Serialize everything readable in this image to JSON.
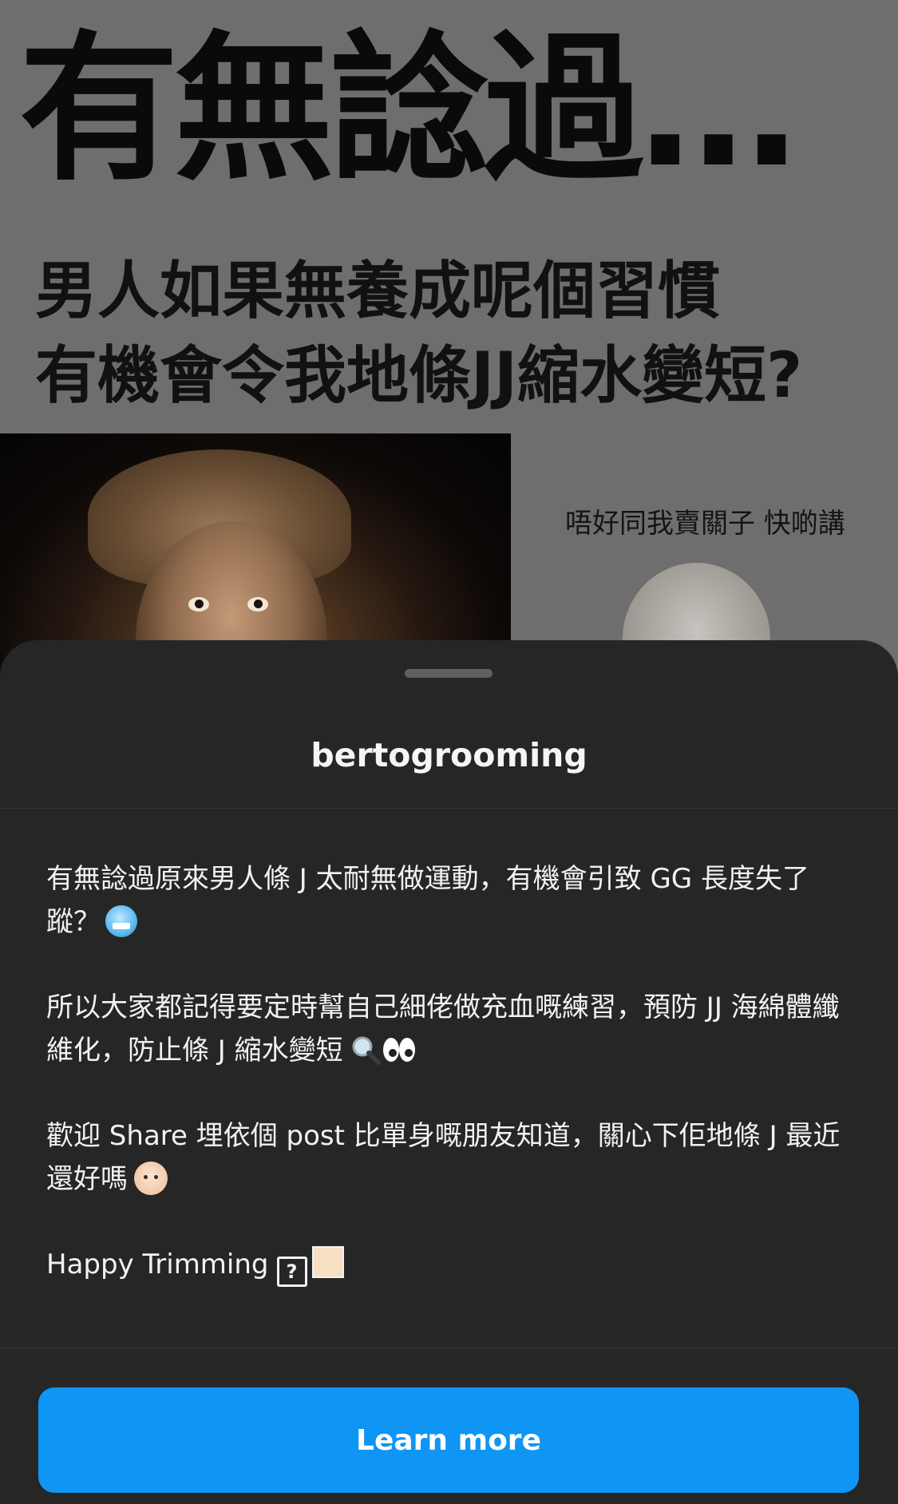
{
  "post_image": {
    "headline": "有無諗過…",
    "subheadline_line1": "男人如果無養成呢個習慣",
    "subheadline_line2": "有機會令我地條JJ縮水變短?",
    "photo_caption": "唔好同我賣關子 快啲講"
  },
  "sheet": {
    "title": "bertogrooming",
    "caption": {
      "p1": "有無諗過原來男人條 J 太耐無做運動，有機會引致 GG 長度失了蹤？",
      "p1_emoji": "cold-face-emoji",
      "p2": "所以大家都記得要定時幫自己細佬做充血嘅練習，預防 JJ 海綿體纖維化，防止條 J 縮水變短",
      "p2_emojis": [
        "magnifying-glass-emoji",
        "eyes-emoji"
      ],
      "p3": "歡迎 Share 埋依個 post 比單身嘅朋友知道，關心下佢地條 J 最近還好嗎",
      "p3_emoji": "baby-emoji",
      "p4": "Happy Trimming",
      "p4_box": "?",
      "p4_swatch_color": "#f7dfc3"
    },
    "cta_label": "Learn more"
  },
  "colors": {
    "sheet_background": "#262626",
    "cta_background": "#0f95f4",
    "image_background": "#6e6e6e"
  }
}
